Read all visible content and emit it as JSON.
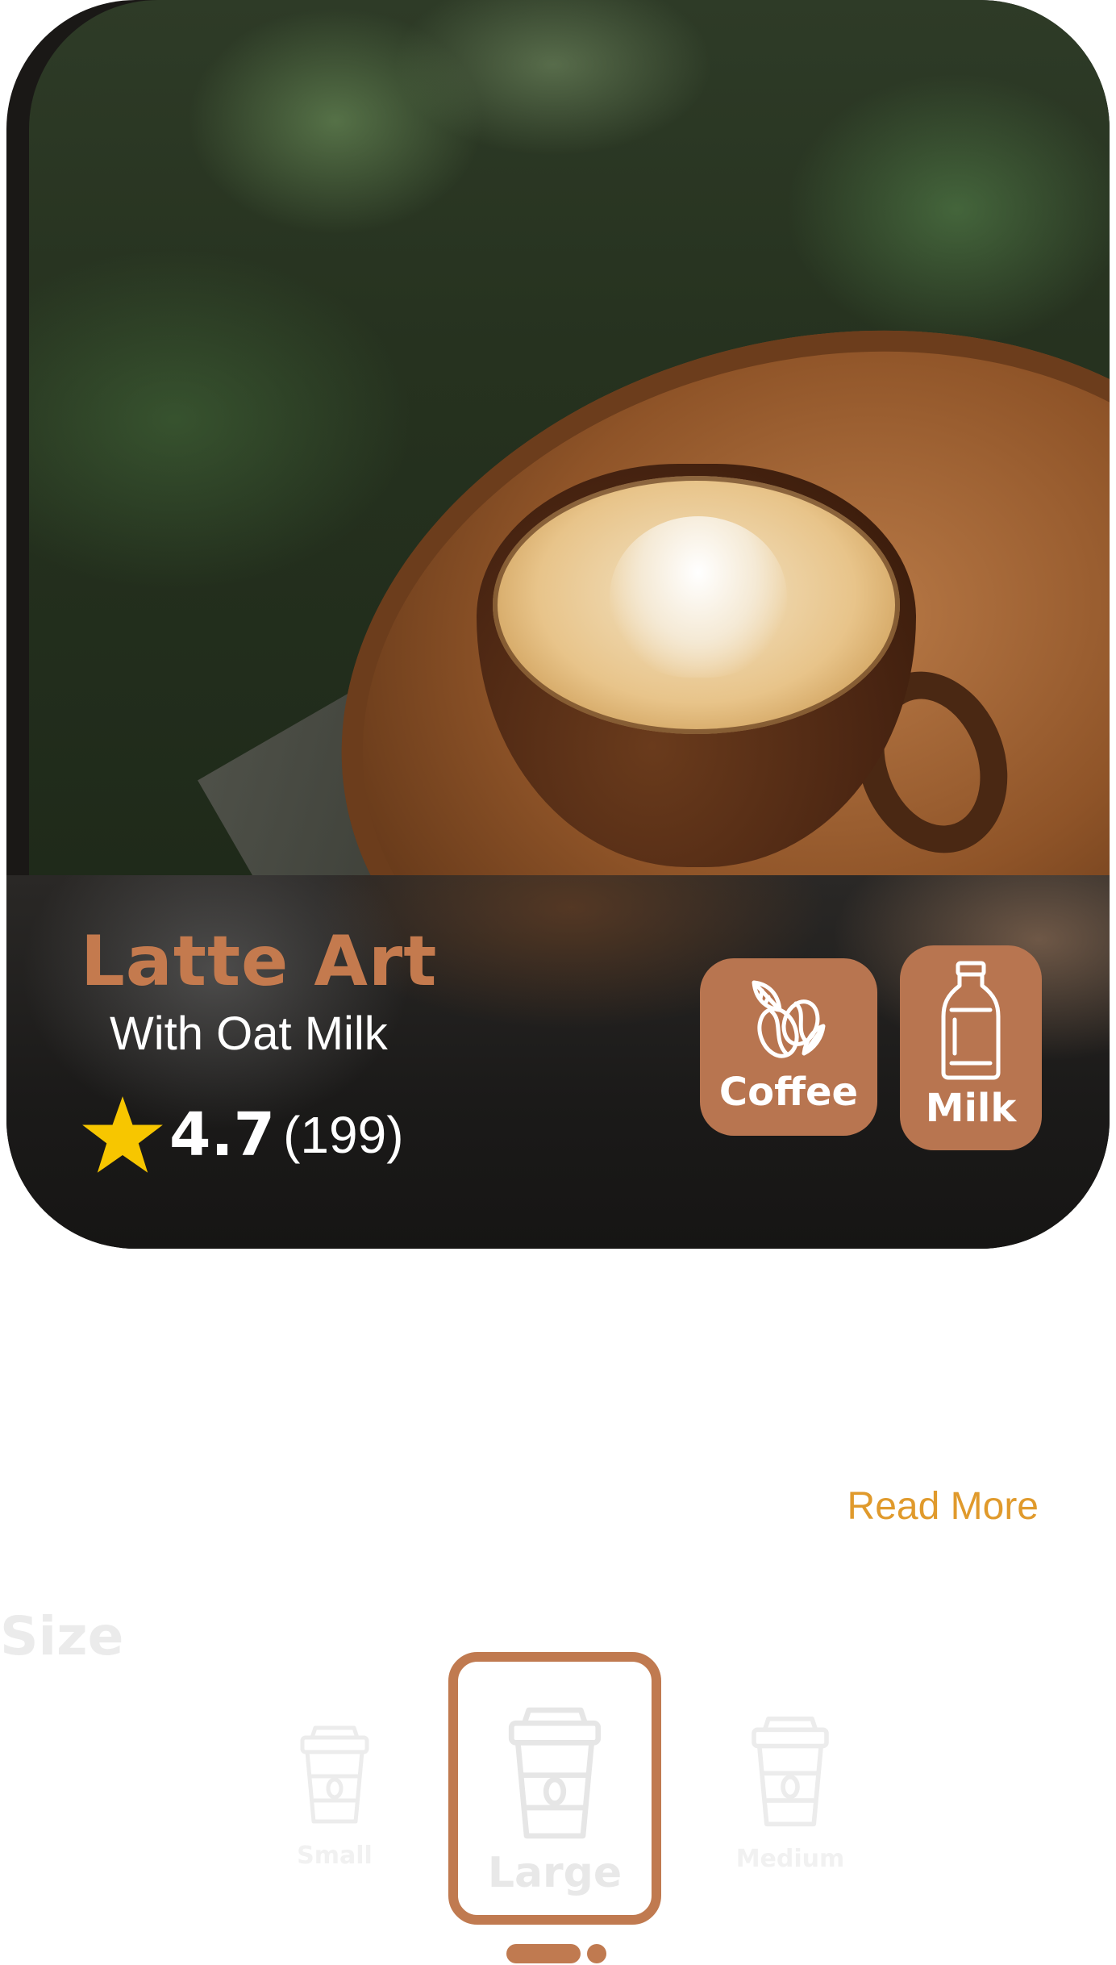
{
  "product": {
    "title": "Latte Art",
    "subtitle": "With Oat Milk",
    "rating_value": "4.7",
    "rating_count": "(199)",
    "image_icon": "latte-photo"
  },
  "ingredients": [
    {
      "label": "Coffee",
      "icon": "coffee-beans-icon"
    },
    {
      "label": "Milk",
      "icon": "milk-bottle-icon"
    }
  ],
  "description": {
    "read_more_label": "Read More"
  },
  "size": {
    "heading": "Size",
    "options": [
      {
        "label": "Small",
        "icon": "coffee-cup-icon",
        "selected": false
      },
      {
        "label": "Large",
        "icon": "coffee-cup-icon",
        "selected": true
      },
      {
        "label": "Medium",
        "icon": "coffee-cup-icon",
        "selected": false
      }
    ]
  },
  "colors": {
    "accent": "#c07a50",
    "title": "#c47a4e",
    "read_more": "#e09a2c",
    "star": "#f7c600",
    "muted": "#ebebeb"
  }
}
